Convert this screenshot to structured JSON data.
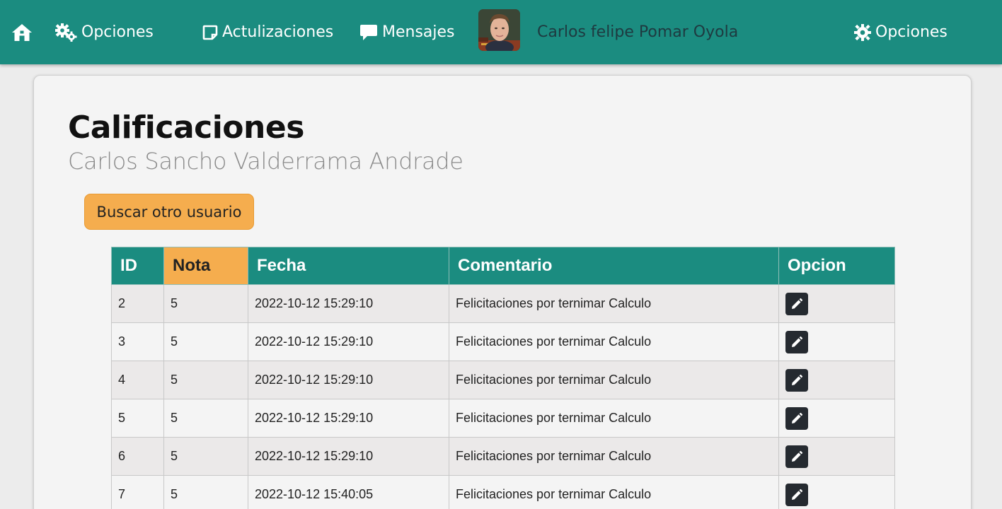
{
  "navbar": {
    "home_icon": "home-icon",
    "options_left": {
      "label": "Opciones",
      "icon": "gears-icon"
    },
    "updates": {
      "label": "Actulizaciones",
      "icon": "note-icon"
    },
    "messages": {
      "label": "Mensajes",
      "icon": "comment-icon"
    },
    "user_name": "Carlos felipe Pomar Oyola",
    "options_right": {
      "label": "Opciones",
      "icon": "gear-icon"
    }
  },
  "main": {
    "title": "Calificaciones",
    "subtitle": "Carlos Sancho Valderrama Andrade",
    "search_button": "Buscar otro usuario"
  },
  "table": {
    "headers": {
      "id": "ID",
      "nota": "Nota",
      "fecha": "Fecha",
      "comentario": "Comentario",
      "opcion": "Opcion"
    },
    "rows": [
      {
        "id": "2",
        "nota": "5",
        "fecha": "2022-10-12 15:29:10",
        "comentario": "Felicitaciones por ternimar Calculo"
      },
      {
        "id": "3",
        "nota": "5",
        "fecha": "2022-10-12 15:29:10",
        "comentario": "Felicitaciones por ternimar Calculo"
      },
      {
        "id": "4",
        "nota": "5",
        "fecha": "2022-10-12 15:29:10",
        "comentario": "Felicitaciones por ternimar Calculo"
      },
      {
        "id": "5",
        "nota": "5",
        "fecha": "2022-10-12 15:29:10",
        "comentario": "Felicitaciones por ternimar Calculo"
      },
      {
        "id": "6",
        "nota": "5",
        "fecha": "2022-10-12 15:29:10",
        "comentario": "Felicitaciones por ternimar Calculo"
      },
      {
        "id": "7",
        "nota": "5",
        "fecha": "2022-10-12 15:40:05",
        "comentario": "Felicitaciones por ternimar Calculo"
      }
    ]
  },
  "colors": {
    "primary": "#1b8c80",
    "accent": "#f5ad4e",
    "dark_button": "#252a30"
  }
}
